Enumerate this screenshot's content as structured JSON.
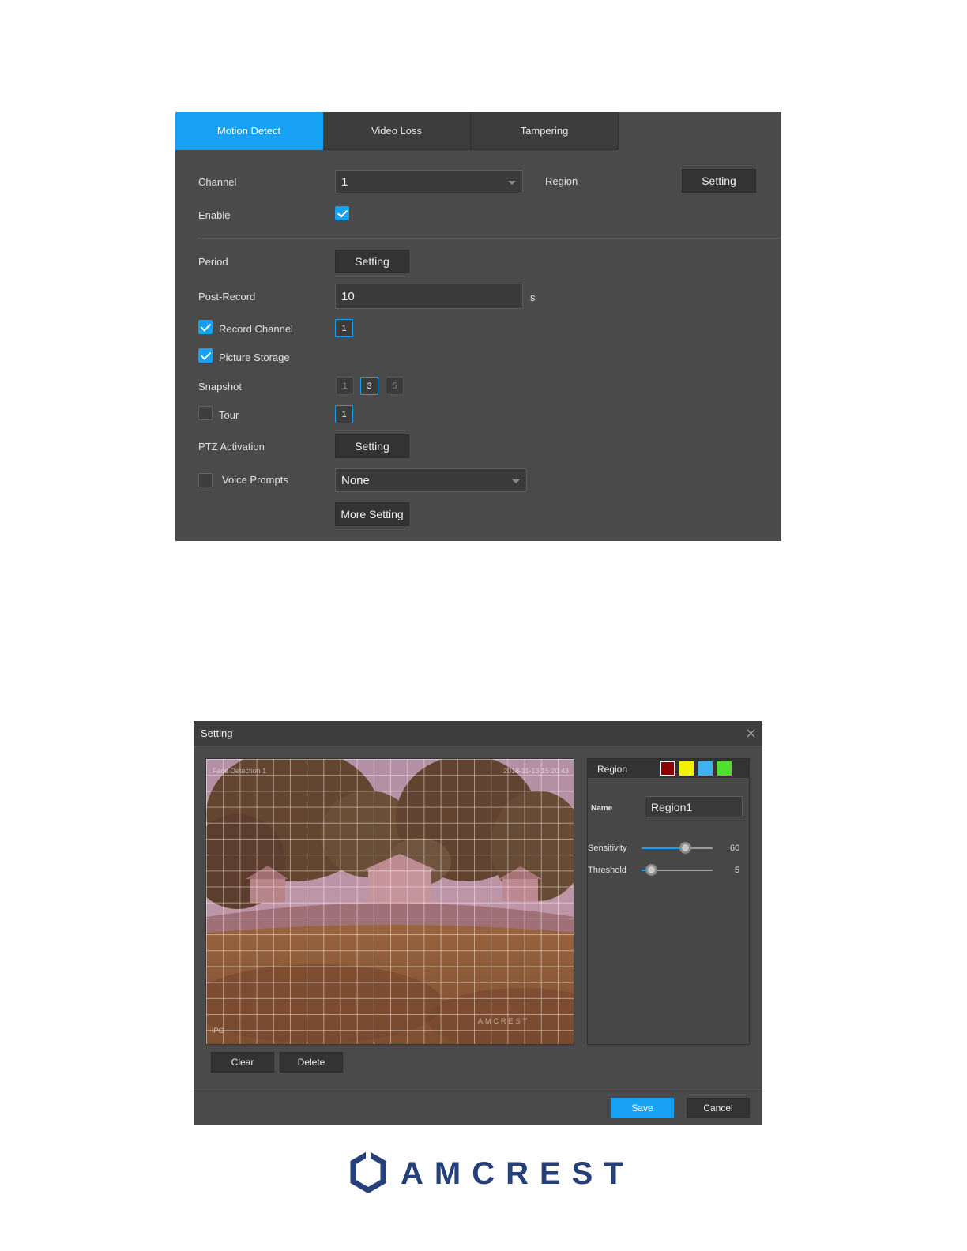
{
  "motion_detect": {
    "tabs": [
      "Motion Detect",
      "Video Loss",
      "Tampering"
    ],
    "channel_label": "Channel",
    "channel_value": "1",
    "region_label": "Region",
    "region_button": "Setting",
    "enable_label": "Enable",
    "enable_checked": true,
    "period_label": "Period",
    "period_button": "Setting",
    "post_record_label": "Post-Record",
    "post_record_value": "10",
    "post_record_unit": "s",
    "record_channel_label": "Record Channel",
    "record_channel_checked": true,
    "record_channel_value": "1",
    "picture_storage_label": "Picture Storage",
    "picture_storage_checked": true,
    "snapshot_label": "Snapshot",
    "snapshot_channels": [
      "1",
      "3",
      "5"
    ],
    "snapshot_selected": "3",
    "tour_label": "Tour",
    "tour_checked": false,
    "tour_channel": "1",
    "ptz_label": "PTZ Activation",
    "ptz_button": "Setting",
    "voice_label": "Voice Prompts",
    "voice_checked": false,
    "voice_value": "None",
    "more_setting_button": "More Setting"
  },
  "setting_dialog": {
    "title": "Setting",
    "osd_top_left": "Face Detection 1",
    "osd_top_right": "2018-11-13 15:20:43",
    "osd_bottom_left": "IPC",
    "osd_watermark": "AMCREST",
    "region_label": "Region",
    "region_colors": [
      "#8b0000",
      "#f2f200",
      "#3fb0f0",
      "#4ee02c"
    ],
    "name_label": "Name",
    "name_value": "Region1",
    "sensitivity_label": "Sensitivity",
    "sensitivity_value": "60",
    "threshold_label": "Threshold",
    "threshold_value": "5",
    "clear_button": "Clear",
    "delete_button": "Delete",
    "save_button": "Save",
    "cancel_button": "Cancel"
  },
  "brand": {
    "name": "AMCREST",
    "color": "#243f7a",
    "accent_color": "#17a1f5"
  }
}
